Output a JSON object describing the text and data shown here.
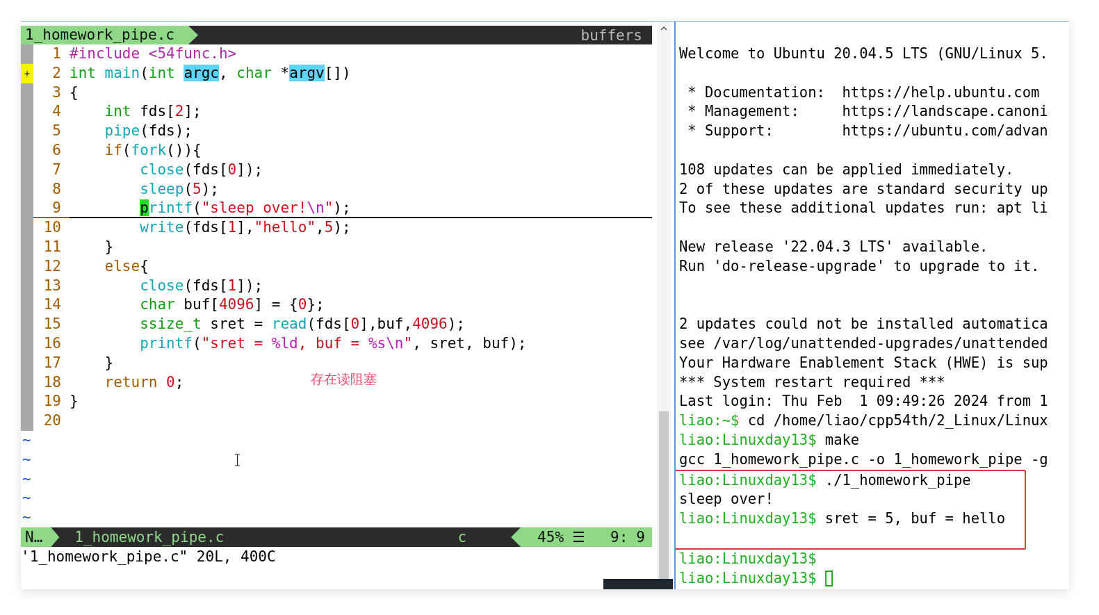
{
  "editor": {
    "tab_title": "1_homework_pipe.c",
    "buffers_label": "buffers",
    "lines": [
      {
        "number": "1",
        "sign": false,
        "cursor_line": false,
        "tokens": [
          {
            "kind": "preproc",
            "text": "#include <54func.h>"
          }
        ]
      },
      {
        "number": "2",
        "sign": true,
        "cursor_line": false,
        "tokens": [
          {
            "kind": "type",
            "text": "int "
          },
          {
            "kind": "func",
            "text": "main"
          },
          {
            "kind": "plain",
            "text": "("
          },
          {
            "kind": "type",
            "text": "int "
          },
          {
            "kind": "search",
            "text": "argc"
          },
          {
            "kind": "plain",
            "text": ", "
          },
          {
            "kind": "type",
            "text": "char"
          },
          {
            "kind": "plain",
            "text": " *"
          },
          {
            "kind": "search",
            "text": "argv"
          },
          {
            "kind": "plain",
            "text": "[])"
          }
        ]
      },
      {
        "number": "3",
        "sign": false,
        "cursor_line": false,
        "tokens": [
          {
            "kind": "plain",
            "text": "{"
          }
        ]
      },
      {
        "number": "4",
        "sign": false,
        "cursor_line": false,
        "tokens": [
          {
            "kind": "type",
            "text": "    int"
          },
          {
            "kind": "plain",
            "text": " fds["
          },
          {
            "kind": "number",
            "text": "2"
          },
          {
            "kind": "plain",
            "text": "];"
          }
        ]
      },
      {
        "number": "5",
        "sign": false,
        "cursor_line": false,
        "tokens": [
          {
            "kind": "func",
            "text": "    pipe"
          },
          {
            "kind": "plain",
            "text": "(fds);"
          }
        ]
      },
      {
        "number": "6",
        "sign": false,
        "cursor_line": false,
        "tokens": [
          {
            "kind": "keyword",
            "text": "    if"
          },
          {
            "kind": "plain",
            "text": "("
          },
          {
            "kind": "func",
            "text": "fork"
          },
          {
            "kind": "plain",
            "text": "()){"
          }
        ]
      },
      {
        "number": "7",
        "sign": false,
        "cursor_line": false,
        "tokens": [
          {
            "kind": "func",
            "text": "        close"
          },
          {
            "kind": "plain",
            "text": "(fds["
          },
          {
            "kind": "number",
            "text": "0"
          },
          {
            "kind": "plain",
            "text": "]);"
          }
        ]
      },
      {
        "number": "8",
        "sign": false,
        "cursor_line": false,
        "tokens": [
          {
            "kind": "func",
            "text": "        sleep"
          },
          {
            "kind": "plain",
            "text": "("
          },
          {
            "kind": "number",
            "text": "5"
          },
          {
            "kind": "plain",
            "text": ");"
          }
        ]
      },
      {
        "number": "9",
        "sign": false,
        "cursor_line": true,
        "tokens": [
          {
            "kind": "cursor",
            "text": "        p"
          },
          {
            "kind": "func",
            "text": "rintf"
          },
          {
            "kind": "plain",
            "text": "("
          },
          {
            "kind": "string",
            "text": "\"sleep over!"
          },
          {
            "kind": "special",
            "text": "\\n"
          },
          {
            "kind": "string",
            "text": "\""
          },
          {
            "kind": "plain",
            "text": ");"
          }
        ]
      },
      {
        "number": "10",
        "sign": false,
        "cursor_line": false,
        "tokens": [
          {
            "kind": "func",
            "text": "        write"
          },
          {
            "kind": "plain",
            "text": "(fds["
          },
          {
            "kind": "number",
            "text": "1"
          },
          {
            "kind": "plain",
            "text": "],"
          },
          {
            "kind": "string",
            "text": "\"hello\""
          },
          {
            "kind": "plain",
            "text": ","
          },
          {
            "kind": "number",
            "text": "5"
          },
          {
            "kind": "plain",
            "text": ");"
          }
        ]
      },
      {
        "number": "11",
        "sign": false,
        "cursor_line": false,
        "tokens": [
          {
            "kind": "plain",
            "text": "    }"
          }
        ]
      },
      {
        "number": "12",
        "sign": false,
        "cursor_line": false,
        "tokens": [
          {
            "kind": "keyword",
            "text": "    else"
          },
          {
            "kind": "plain",
            "text": "{"
          }
        ]
      },
      {
        "number": "13",
        "sign": false,
        "cursor_line": false,
        "tokens": [
          {
            "kind": "func",
            "text": "        close"
          },
          {
            "kind": "plain",
            "text": "(fds["
          },
          {
            "kind": "number",
            "text": "1"
          },
          {
            "kind": "plain",
            "text": "]);"
          }
        ]
      },
      {
        "number": "14",
        "sign": false,
        "cursor_line": false,
        "tokens": [
          {
            "kind": "type",
            "text": "        char"
          },
          {
            "kind": "plain",
            "text": " buf["
          },
          {
            "kind": "number",
            "text": "4096"
          },
          {
            "kind": "plain",
            "text": "] = {"
          },
          {
            "kind": "number",
            "text": "0"
          },
          {
            "kind": "plain",
            "text": "};"
          }
        ]
      },
      {
        "number": "15",
        "sign": false,
        "cursor_line": false,
        "tokens": [
          {
            "kind": "type",
            "text": "        ssize_t"
          },
          {
            "kind": "plain",
            "text": " sret = "
          },
          {
            "kind": "func",
            "text": "read"
          },
          {
            "kind": "plain",
            "text": "(fds["
          },
          {
            "kind": "number",
            "text": "0"
          },
          {
            "kind": "plain",
            "text": "],buf,"
          },
          {
            "kind": "number",
            "text": "4096"
          },
          {
            "kind": "plain",
            "text": ");"
          }
        ]
      },
      {
        "number": "16",
        "sign": false,
        "cursor_line": false,
        "tokens": [
          {
            "kind": "func",
            "text": "        printf"
          },
          {
            "kind": "plain",
            "text": "("
          },
          {
            "kind": "string",
            "text": "\"sret = "
          },
          {
            "kind": "special",
            "text": "%ld"
          },
          {
            "kind": "string",
            "text": ", buf = "
          },
          {
            "kind": "special",
            "text": "%s\\n"
          },
          {
            "kind": "string",
            "text": "\""
          },
          {
            "kind": "plain",
            "text": ", sret, buf);"
          }
        ]
      },
      {
        "number": "17",
        "sign": false,
        "cursor_line": false,
        "tokens": [
          {
            "kind": "plain",
            "text": "    }"
          }
        ]
      },
      {
        "number": "18",
        "sign": false,
        "cursor_line": false,
        "tokens": [
          {
            "kind": "keyword",
            "text": "    return "
          },
          {
            "kind": "number",
            "text": "0"
          },
          {
            "kind": "plain",
            "text": ";"
          }
        ]
      },
      {
        "number": "19",
        "sign": false,
        "cursor_line": false,
        "tokens": [
          {
            "kind": "plain",
            "text": "}"
          }
        ]
      },
      {
        "number": "20",
        "sign": false,
        "cursor_line": false
      }
    ],
    "tildes": [
      "~",
      "~",
      "~",
      "~",
      "~"
    ],
    "annotation": "存在读阻塞",
    "status": {
      "mode": "N…",
      "file": "1_homework_pipe.c",
      "filetype": "c",
      "percent": "45%",
      "lines_icon": "☰",
      "line": "9:",
      "column": "9"
    },
    "message": "'1_homework_pipe.c\" 20L, 400C"
  },
  "terminal": {
    "blocks": [
      {
        "boxed": false,
        "lines": [
          {
            "kind": "output",
            "text": "Welcome to Ubuntu 20.04.5 LTS (GNU/Linux 5."
          },
          {
            "kind": "blank"
          },
          {
            "kind": "output",
            "text": " * Documentation:  https://help.ubuntu.com"
          },
          {
            "kind": "output",
            "text": " * Management:     https://landscape.canoni"
          },
          {
            "kind": "output",
            "text": " * Support:        https://ubuntu.com/advan"
          },
          {
            "kind": "blank"
          },
          {
            "kind": "output",
            "text": "108 updates can be applied immediately."
          },
          {
            "kind": "output",
            "text": "2 of these updates are standard security up"
          },
          {
            "kind": "output",
            "text": "To see these additional updates run: apt li"
          },
          {
            "kind": "blank"
          },
          {
            "kind": "output",
            "text": "New release '22.04.3 LTS' available."
          },
          {
            "kind": "output",
            "text": "Run 'do-release-upgrade' to upgrade to it."
          },
          {
            "kind": "blank"
          },
          {
            "kind": "blank"
          },
          {
            "kind": "output",
            "text": "2 updates could not be installed automatica"
          },
          {
            "kind": "output",
            "text": "see /var/log/unattended-upgrades/unattended"
          },
          {
            "kind": "output",
            "text": "Your Hardware Enablement Stack (HWE) is sup"
          },
          {
            "kind": "output",
            "text": "*** System restart required ***"
          },
          {
            "kind": "output",
            "text": "Last login: Thu Feb  1 09:49:26 2024 from 1"
          },
          {
            "kind": "prompt",
            "prompt": "liao:~$",
            "command": "cd /home/liao/cpp54th/2_Linux/Linux",
            "cursor": false
          },
          {
            "kind": "prompt",
            "prompt": "liao:Linuxday13$",
            "command": "make",
            "cursor": false
          },
          {
            "kind": "output",
            "text": "gcc 1_homework_pipe.c -o 1_homework_pipe -g"
          }
        ]
      },
      {
        "boxed": true,
        "lines": [
          {
            "kind": "prompt",
            "prompt": "liao:Linuxday13$",
            "command": "./1_homework_pipe",
            "cursor": false
          },
          {
            "kind": "output",
            "text": "sleep over!"
          },
          {
            "kind": "prompt",
            "prompt": "liao:Linuxday13$",
            "command": "sret = 5, buf = hello",
            "cursor": false
          },
          {
            "kind": "blank"
          }
        ]
      },
      {
        "boxed": false,
        "lines": [
          {
            "kind": "prompt",
            "prompt": "liao:Linuxday13$",
            "cursor": false
          },
          {
            "kind": "prompt",
            "prompt": "liao:Linuxday13$",
            "cursor": true
          }
        ]
      }
    ]
  }
}
